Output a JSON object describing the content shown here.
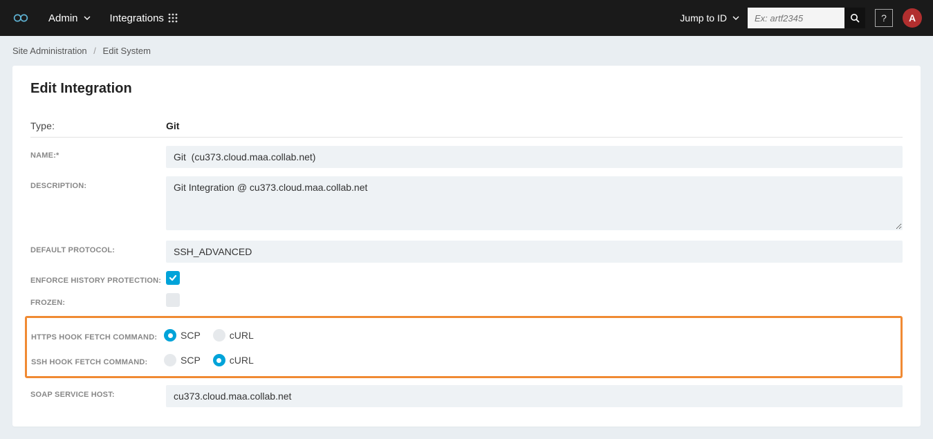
{
  "topbar": {
    "admin_label": "Admin",
    "integrations_label": "Integrations",
    "jump_label": "Jump to ID",
    "search_placeholder": "Ex: artf2345",
    "help_label": "?",
    "avatar_initial": "A"
  },
  "breadcrumb": {
    "site_admin": "Site Administration",
    "edit_system": "Edit System"
  },
  "page": {
    "title": "Edit Integration"
  },
  "form": {
    "type_label": "Type:",
    "type_value": "Git",
    "name_label": "NAME:*",
    "name_value": "Git  (cu373.cloud.maa.collab.net)",
    "description_label": "DESCRIPTION:",
    "description_value": "Git Integration @ cu373.cloud.maa.collab.net",
    "default_protocol_label": "DEFAULT PROTOCOL:",
    "default_protocol_value": "SSH_ADVANCED",
    "enforce_history_label": "ENFORCE HISTORY PROTECTION:",
    "enforce_history_checked": true,
    "frozen_label": "FROZEN:",
    "frozen_checked": false,
    "https_hook_label": "HTTPS HOOK FETCH COMMAND:",
    "https_hook_options": {
      "scp": "SCP",
      "curl": "cURL"
    },
    "https_hook_selected": "scp",
    "ssh_hook_label": "SSH HOOK FETCH COMMAND:",
    "ssh_hook_options": {
      "scp": "SCP",
      "curl": "cURL"
    },
    "ssh_hook_selected": "curl",
    "soap_host_label": "SOAP SERVICE HOST:",
    "soap_host_value": "cu373.cloud.maa.collab.net"
  }
}
